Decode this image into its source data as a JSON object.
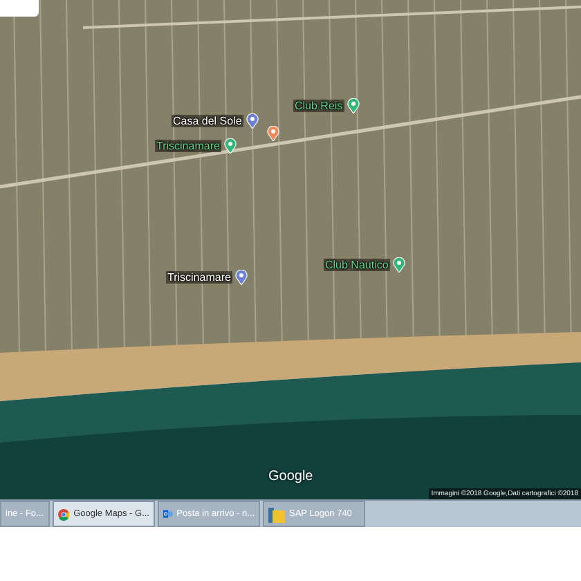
{
  "map": {
    "places": [
      {
        "name": "Casa del Sole",
        "kind": "lodging"
      },
      {
        "kind": "pin"
      },
      {
        "name": "Club Reis",
        "kind": "activity"
      },
      {
        "name": "Triscinamare",
        "kind": "park"
      },
      {
        "name": "Triscinamare",
        "kind": "lodging"
      },
      {
        "name": "Club Nautico",
        "kind": "activity"
      }
    ],
    "logo": "Google",
    "attribution": "Immagini ©2018 Google,Dati cartografici ©2018"
  },
  "taskbar": {
    "items": [
      {
        "label": "ine - Fo...",
        "kind": "window",
        "selected": false
      },
      {
        "label": "Google Maps - G...",
        "kind": "chrome",
        "selected": true
      },
      {
        "label": "Posta in arrivo - n...",
        "kind": "mail",
        "selected": false
      },
      {
        "label": "SAP Logon 740",
        "kind": "sap",
        "selected": false
      }
    ]
  }
}
